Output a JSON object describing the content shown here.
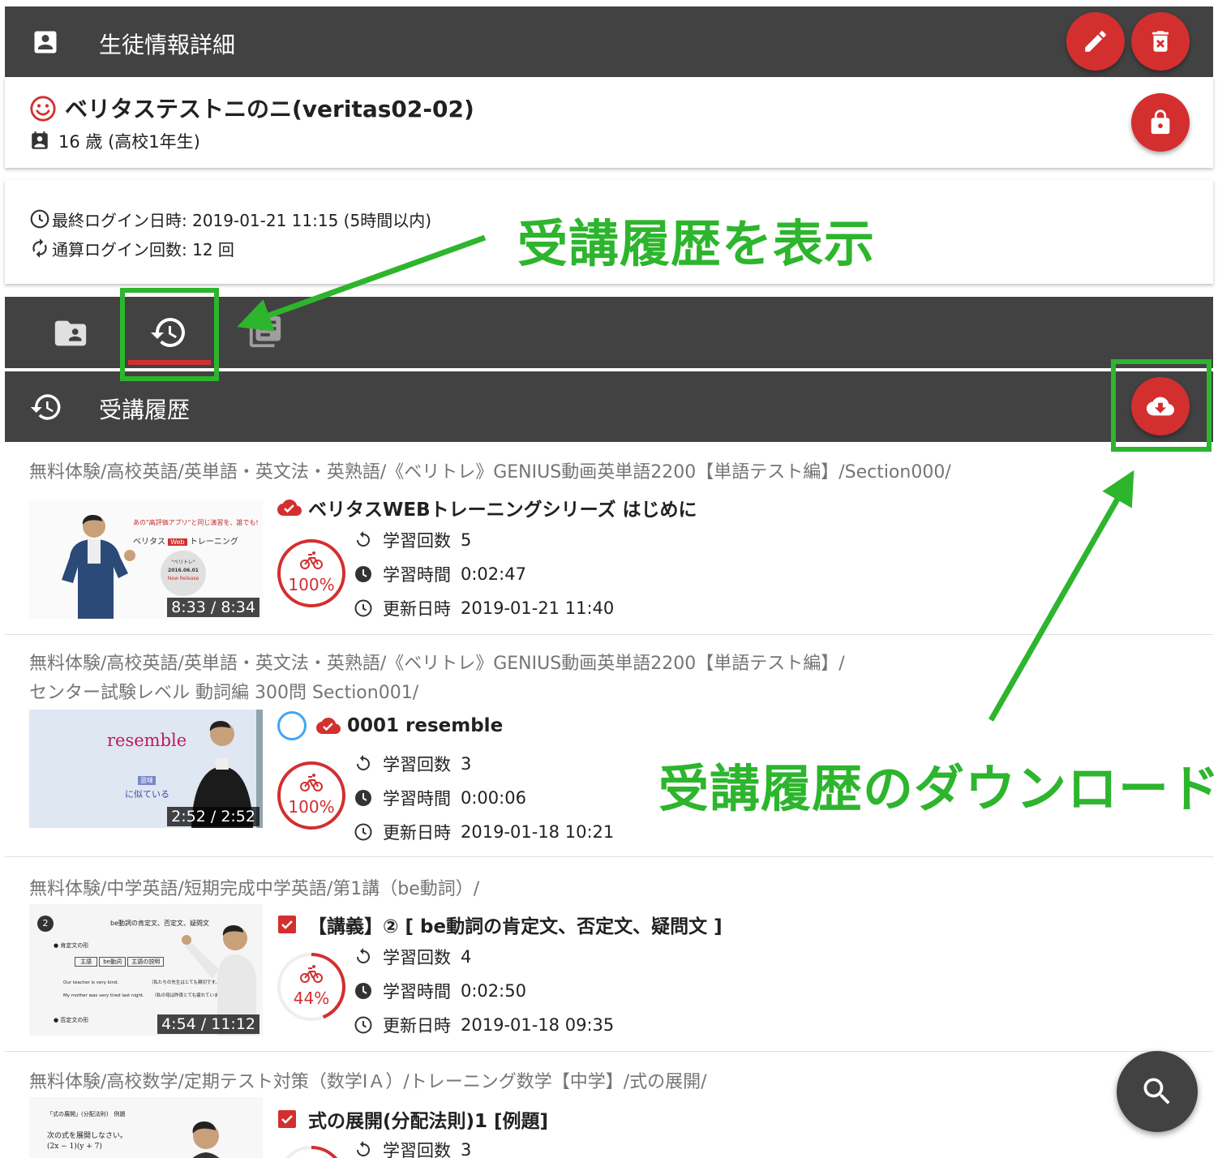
{
  "header": {
    "title": "生徒情報詳細"
  },
  "student": {
    "name": "ベリタステストニのニ(veritas02-02)",
    "age_text": "16 歳 (高校1年生)"
  },
  "login": {
    "last_login": "最終ログイン日時: 2019-01-21 11:15 (5時間以内)",
    "total_login": "通算ログイン回数: 12 回"
  },
  "section": {
    "title": "受講履歴"
  },
  "annotations": {
    "show_history": "受講履歴を表示",
    "download_history": "受講履歴のダウンロード"
  },
  "stat_labels": {
    "count": "学習回数",
    "time": "学習時間",
    "updated": "更新日時"
  },
  "entries": [
    {
      "path1": "無料体験/高校英語/英単語・英文法・英熟語/《ベリトレ》GENIUS動画英単語2200【単語テスト編】/Section000/",
      "title": "ベリタスWEBトレーニングシリーズ はじめに",
      "duration": "8:33 / 8:34",
      "progress": "100%",
      "progress_value": 1.0,
      "count": "5",
      "time": "0:02:47",
      "updated": "2019-01-21 11:40",
      "thumb_text": {
        "top": "あの\"高評価アプリ\"と同じ演習を、誰でも!",
        "brand1": "ベリタス",
        "brand_badge": "Web",
        "brand2": "トレーニング",
        "circle1": "\"ベリトレ\"",
        "circle2": "2016.06.01",
        "circle3": "New Release"
      }
    },
    {
      "path1": "無料体験/高校英語/英単語・英文法・英熟語/《ベリトレ》GENIUS動画英単語2200【単語テスト編】/",
      "path2": "センター試験レベル 動詞編 300問 Section001/",
      "title": "0001 resemble",
      "duration": "2:52 / 2:52",
      "progress": "100%",
      "progress_value": 1.0,
      "count": "3",
      "time": "0:00:06",
      "updated": "2019-01-18 10:21",
      "thumb_text": {
        "word": "resemble",
        "tag": "意味",
        "meaning": "に似ている"
      }
    },
    {
      "path1": "無料体験/中学英語/短期完成中学英語/第1講（be動詞）/",
      "title": "【講義】② [ be動詞の肯定文、否定文、疑問文 ]",
      "duration": "4:54 / 11:12",
      "progress": "44%",
      "progress_value": 0.44,
      "count": "4",
      "time": "0:02:50",
      "updated": "2019-01-18 09:35",
      "thumb_text": {
        "num": "2",
        "heading": "be動詞の肯定文、否定文、疑問文",
        "b1": "● 肯定文の形",
        "c1": "主語",
        "c2": "be動詞",
        "c3": "主語の説明",
        "s1": "Our teacher is very kind.",
        "j1": "（私たちの先生はとても親切です。）",
        "s2": "My mother was very tired last night.",
        "j2": "（私の母は昨夜とても疲れていました。）",
        "b2": "● 否定文の形"
      }
    },
    {
      "path1": "無料体験/高校数学/定期テスト対策（数学ⅠＡ）/トレーニング数学【中学】/式の展開/",
      "title": "式の展開(分配法則)1 [例題]",
      "count": "3",
      "progress_value": 0.3,
      "thumb_text": {
        "label": "「式の展開」(分配法則)　例題",
        "q": "次の式を展開しなさい。",
        "expr": "(2x − 1)(y + 7)"
      }
    }
  ],
  "colors": {
    "red": "#d32f2f",
    "dark": "#424242",
    "green": "#2db52d",
    "blue": "#1e88e5"
  }
}
